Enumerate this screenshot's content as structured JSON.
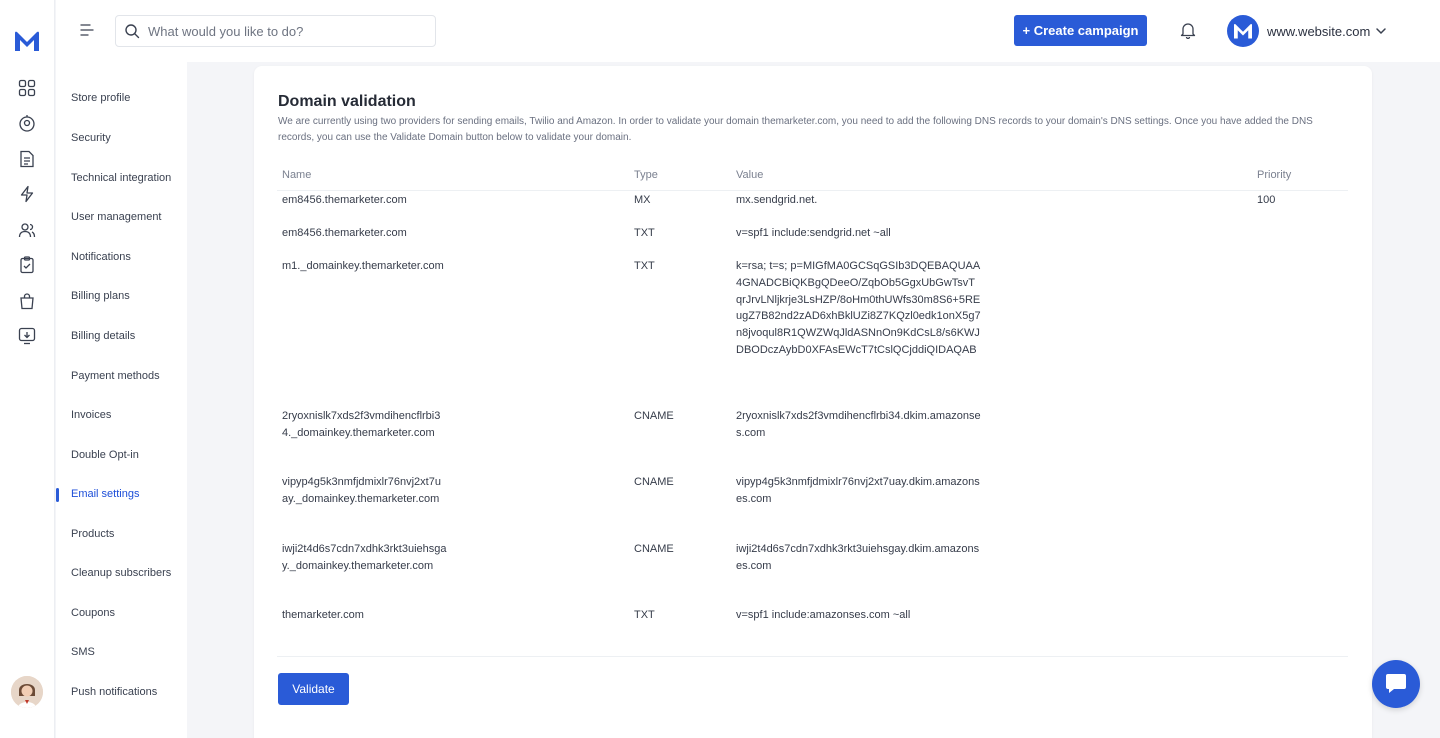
{
  "header": {
    "search_placeholder": "What would you like to do?",
    "create_label": "+ Create campaign",
    "account_name": "www.website.com"
  },
  "colors": {
    "accent": "#2a5bd7"
  },
  "icons": {
    "rail": [
      "dashboard-icon",
      "contacts-icon",
      "forms-icon",
      "automation-icon",
      "audience-icon",
      "tasks-icon",
      "shop-icon",
      "download-icon"
    ],
    "top": [
      "menu-toggle-icon",
      "search-icon",
      "bell-icon",
      "chevron-down-icon"
    ]
  },
  "menu": {
    "items": [
      "Store profile",
      "Security",
      "Technical integration",
      "User management",
      "Notifications",
      "Billing plans",
      "Billing details",
      "Payment methods",
      "Invoices",
      "Double Opt-in",
      "Email settings",
      "Products",
      "Cleanup subscribers",
      "Coupons",
      "SMS",
      "Push notifications"
    ],
    "active": "Email settings"
  },
  "section": {
    "title": "Domain validation",
    "description": "We are currently using two providers for sending emails, Twilio and Amazon. In order to validate your domain themarketer.com, you need to add the following DNS records to your domain's DNS settings. Once you have added the DNS records, you can use the Validate Domain button below to validate your domain."
  },
  "table": {
    "columns": {
      "name": "Name",
      "type": "Type",
      "value": "Value",
      "priority": "Priority"
    },
    "rows": [
      {
        "name": "em8456.themarketer.com",
        "type": "MX",
        "value": "mx.sendgrid.net.",
        "priority": "100"
      },
      {
        "name": "em8456.themarketer.com",
        "type": "TXT",
        "value": "v=spf1 include:sendgrid.net ~all",
        "priority": ""
      },
      {
        "name": "m1._domainkey.themarketer.com",
        "type": "TXT",
        "value": "k=rsa; t=s; p=MIGfMA0GCSqGSIb3DQEBAQUAA4GNADCBiQKBgQDeeO/ZqbOb5GgxUbGwTsvTqrJrvLNljkrje3LsHZP/8oHm0thUWfs30m8S6+5REugZ7B82nd2zAD6xhBklUZi8Z7KQzl0edk1onX5g7n8jvoqul8R1QWZWqJldASNnOn9KdCsL8/s6KWJDBODczAybD0XFAsEWcT7tCslQCjddiQIDAQAB",
        "priority": ""
      },
      {
        "name": "2ryoxnislk7xds2f3vmdihencflrbi34._domainkey.themarketer.com",
        "type": "CNAME",
        "value": "2ryoxnislk7xds2f3vmdihencflrbi34.dkim.amazonses.com",
        "priority": ""
      },
      {
        "name": "vipyp4g5k3nmfjdmixlr76nvj2xt7uay._domainkey.themarketer.com",
        "type": "CNAME",
        "value": "vipyp4g5k3nmfjdmixlr76nvj2xt7uay.dkim.amazonses.com",
        "priority": ""
      },
      {
        "name": "iwji2t4d6s7cdn7xdhk3rkt3uiehsgay._domainkey.themarketer.com",
        "type": "CNAME",
        "value": "iwji2t4d6s7cdn7xdhk3rkt3uiehsgay.dkim.amazonses.com",
        "priority": ""
      },
      {
        "name": "themarketer.com",
        "type": "TXT",
        "value": "v=spf1 include:amazonses.com ~all",
        "priority": ""
      }
    ]
  },
  "actions": {
    "validate_label": "Validate"
  }
}
